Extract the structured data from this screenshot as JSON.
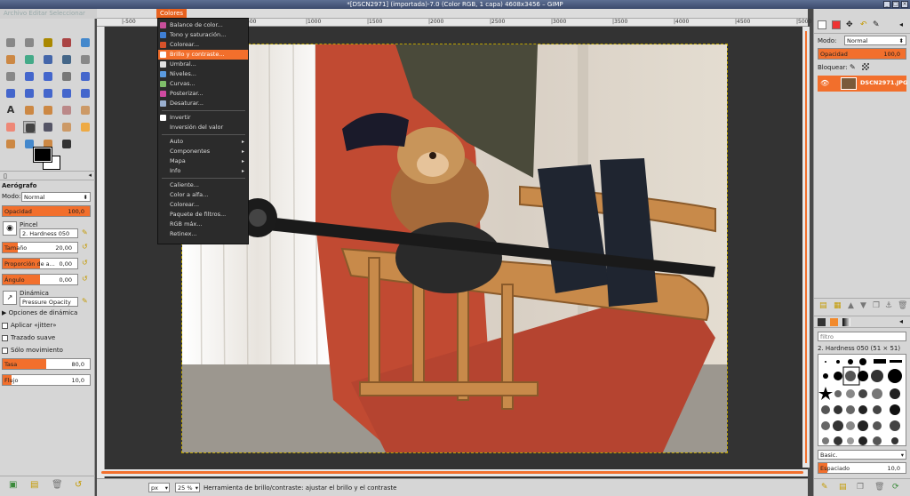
{
  "window": {
    "title": "*[DSCN2971] (importada)-7.0 (Color RGB, 1 capa) 4608x3456 – GIMP"
  },
  "menubar": {
    "ghost_items": "Archivo  Editar  Seleccionar",
    "items": [
      "Colores"
    ]
  },
  "colors_menu": {
    "items": [
      {
        "label": "Balance de color...",
        "icon": "color-balance-icon",
        "color": "#c94f9b"
      },
      {
        "label": "Tono y saturación...",
        "icon": "hue-saturation-icon",
        "color": "#3f7fd4"
      },
      {
        "label": "Colorear...",
        "icon": "colorize-icon",
        "color": "#d8522a"
      },
      {
        "label": "Brillo y contraste...",
        "icon": "brightness-contrast-icon",
        "color": "#ffffff",
        "highlighted": true
      },
      {
        "label": "Umbral...",
        "icon": "threshold-icon",
        "color": "#e0e0e0"
      },
      {
        "label": "Niveles...",
        "icon": "levels-icon",
        "color": "#5a9ae0"
      },
      {
        "label": "Curvas...",
        "icon": "curves-icon",
        "color": "#7fbf6a"
      },
      {
        "label": "Posterizar...",
        "icon": "posterize-icon",
        "color": "#d04aa0"
      },
      {
        "label": "Desaturar...",
        "icon": "desaturate-icon",
        "color": "#9ab0d0"
      },
      {
        "label": "Invertir",
        "icon": "invert-icon",
        "color": "#ffffff"
      },
      {
        "label": "Inversión del valor",
        "icon": "",
        "color": ""
      },
      {
        "label": "Auto",
        "submenu": true
      },
      {
        "label": "Componentes",
        "submenu": true
      },
      {
        "label": "Mapa",
        "submenu": true
      },
      {
        "label": "Info",
        "submenu": true
      },
      {
        "label": "Caliente..."
      },
      {
        "label": "Color a alfa..."
      },
      {
        "label": "Colorear..."
      },
      {
        "label": "Paquete de filtros..."
      },
      {
        "label": "RGB máx..."
      },
      {
        "label": "Retinex..."
      }
    ]
  },
  "ruler": {
    "ticks": [
      "|-500",
      "|0",
      "|500",
      "|1000",
      "|1500",
      "|2000",
      "|2500",
      "|3000",
      "|3500",
      "|4000",
      "|4500",
      "|5000"
    ]
  },
  "tool_options": {
    "header": "Aerógrafo",
    "mode_label": "Modo:",
    "mode_value": "Normal",
    "opacity_label": "Opacidad",
    "opacity_value": "100,0",
    "opacity_fraction": 1.0,
    "brush_label": "Pincel",
    "brush_value": "2. Hardness 050",
    "size_label": "Tamaño",
    "size_value": "20,00",
    "size_fraction": 0.2,
    "aspect_label": "Proporción de a...",
    "aspect_value": "0,00",
    "aspect_fraction": 0.5,
    "angle_label": "Ángulo",
    "angle_value": "0,00",
    "angle_fraction": 0.5,
    "dynamics_label": "Dinámica",
    "dynamics_value": "Pressure Opacity",
    "dynamics_options": "Opciones de dinámica",
    "jitter": "Aplicar «jitter»",
    "smooth": "Trazado suave",
    "motion_only": "Sólo movimiento",
    "rate_label": "Tasa",
    "rate_value": "80,0",
    "rate_fraction": 0.5,
    "flow_label": "Flujo",
    "flow_value": "10,0",
    "flow_fraction": 0.1
  },
  "status": {
    "unit": "px",
    "zoom": "25 %",
    "message": "Herramienta de brillo/contraste: ajustar el brillo y el contraste"
  },
  "layers": {
    "mode_label": "Modo:",
    "mode_value": "Normal",
    "opacity_label": "Opacidad",
    "opacity_value": "100,0",
    "lock_label": "Bloquear:",
    "layer_name": "DSCN2971.JPG"
  },
  "brushes": {
    "filter_placeholder": "filtro",
    "selected_brush": "2. Hardness 050 (51 × 51)",
    "preset": "Basic.",
    "spacing_label": "Espaciado",
    "spacing_value": "10,0",
    "spacing_fraction": 0.1
  },
  "colors": {
    "accent": "#f26f2c",
    "menu_bg": "#2b2b2b",
    "titlebar": "#4b5b7f"
  }
}
